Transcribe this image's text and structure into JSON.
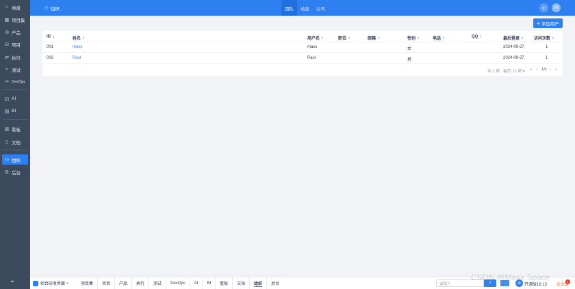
{
  "sidebar": {
    "items": [
      {
        "icon": "home-icon",
        "label": "地盘"
      },
      {
        "icon": "grid-icon",
        "label": "项目集"
      },
      {
        "icon": "product-icon",
        "label": "产品"
      },
      {
        "icon": "project-icon",
        "label": "项目"
      },
      {
        "icon": "execute-icon",
        "label": "执行"
      },
      {
        "icon": "test-icon",
        "label": "测试"
      },
      {
        "icon": "devops-icon",
        "label": "DevOps"
      },
      {
        "icon": "ai-icon",
        "label": "AI"
      },
      {
        "icon": "bi-icon",
        "label": "BI"
      },
      {
        "icon": "kanban-icon",
        "label": "看板"
      },
      {
        "icon": "doc-icon",
        "label": "文档"
      },
      {
        "icon": "org-icon",
        "label": "组织"
      },
      {
        "icon": "admin-icon",
        "label": "后台"
      }
    ],
    "collapse_icon": "collapse-icon"
  },
  "header": {
    "crumb": "组织",
    "tabs": [
      "团队",
      "动态",
      "公司"
    ],
    "active_tab": "团队",
    "avatar_text": "M",
    "accent": "#2e7ff0"
  },
  "toolbar": {
    "add_user_label": "添加用户"
  },
  "table": {
    "columns": [
      "ID",
      "姓名",
      "用户名",
      "职位",
      "邮箱",
      "性别",
      "电话",
      "QQ",
      "最后登录",
      "访问次数"
    ],
    "rows": [
      {
        "id": "001",
        "name": "maxx",
        "username": "maxx",
        "position": "",
        "email": "",
        "gender": "女",
        "phone": "",
        "qq": "",
        "last_login": "2024-09-27",
        "visits": "1"
      },
      {
        "id": "002",
        "name": "Paul",
        "username": "Paul",
        "position": "",
        "email": "",
        "gender": "男",
        "phone": "",
        "qq": "",
        "last_login": "2024-09-27",
        "visits": "1"
      }
    ]
  },
  "pager": {
    "total": "共 2 项",
    "per_page": "每页 15 项",
    "page": "1/1"
  },
  "bottombar": {
    "menu_label": "综合研发界面",
    "apps": [
      "项目集",
      "项目",
      "产品",
      "执行",
      "测试",
      "DevOps",
      "AI",
      "BI",
      "看板",
      "文档",
      "组织",
      "后台"
    ],
    "active_app": "组织",
    "search_placeholder": "请输入",
    "version": "开源版18.13",
    "user_label": "企业版",
    "badge": "1"
  },
  "watermark": "CSDN @Maxx Space"
}
